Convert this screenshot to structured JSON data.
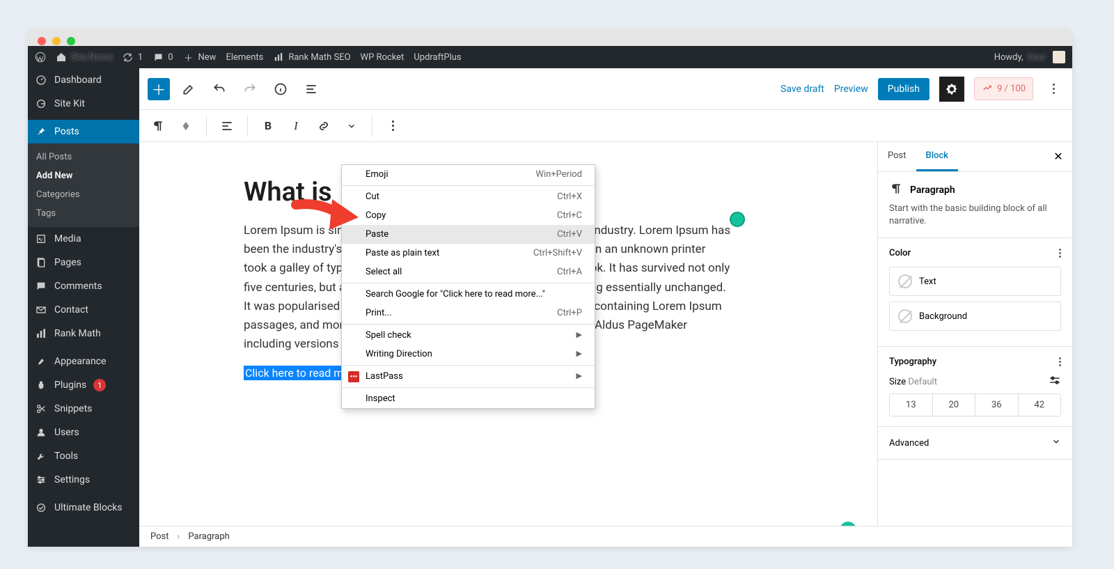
{
  "adminbar": {
    "refresh_count": "1",
    "comment_count": "0",
    "new_label": "New",
    "items": [
      "Elements",
      "Rank Math SEO",
      "WP Rocket",
      "UpdraftPlus"
    ],
    "howdy": "Howdy,"
  },
  "sidebar": {
    "dashboard": "Dashboard",
    "sitekit": "Site Kit",
    "posts": "Posts",
    "posts_sub": {
      "all": "All Posts",
      "add": "Add New",
      "cats": "Categories",
      "tags": "Tags"
    },
    "media": "Media",
    "pages": "Pages",
    "comments": "Comments",
    "contact": "Contact",
    "rankmath": "Rank Math",
    "appearance": "Appearance",
    "plugins": "Plugins",
    "plugins_badge": "1",
    "snippets": "Snippets",
    "users": "Users",
    "tools": "Tools",
    "settings": "Settings",
    "ultimate": "Ultimate Blocks"
  },
  "toolbar": {
    "save_draft": "Save draft",
    "preview": "Preview",
    "publish": "Publish",
    "seo_score": "9 / 100"
  },
  "editor": {
    "title": "What is",
    "body": "Lorem Ipsum is simply dummy text of the printing and typesetting industry. Lorem Ipsum has been the industry's standard dummy text ever since the 1500s, when an unknown printer took a galley of type and scrambled it to make a type specimen book. It has survived not only five centuries, but also the leap into electronic typesetting, remaining essentially unchanged. It was popularised in the 1960s with the release of Letraset sheets containing Lorem Ipsum passages, and more recently with desktop publishing software like Aldus PageMaker including versions of Lorem Ipsum.",
    "highlighted": "Click here to read more..."
  },
  "context_menu": {
    "emoji": "Emoji",
    "emoji_sc": "Win+Period",
    "cut": "Cut",
    "cut_sc": "Ctrl+X",
    "copy": "Copy",
    "copy_sc": "Ctrl+C",
    "paste": "Paste",
    "paste_sc": "Ctrl+V",
    "paste_plain": "Paste as plain text",
    "paste_plain_sc": "Ctrl+Shift+V",
    "select_all": "Select all",
    "select_all_sc": "Ctrl+A",
    "search": "Search Google for \"Click here to read more...\"",
    "print": "Print...",
    "print_sc": "Ctrl+P",
    "spell": "Spell check",
    "writing": "Writing Direction",
    "lastpass": "LastPass",
    "inspect": "Inspect"
  },
  "rightpanel": {
    "tab_post": "Post",
    "tab_block": "Block",
    "block_name": "Paragraph",
    "block_desc": "Start with the basic building block of all narrative.",
    "color": "Color",
    "color_text": "Text",
    "color_bg": "Background",
    "typography": "Typography",
    "size_label": "Size",
    "size_default": "Default",
    "sizes": [
      "13",
      "20",
      "36",
      "42"
    ],
    "advanced": "Advanced"
  },
  "breadcrumb": {
    "post": "Post",
    "block": "Paragraph"
  }
}
